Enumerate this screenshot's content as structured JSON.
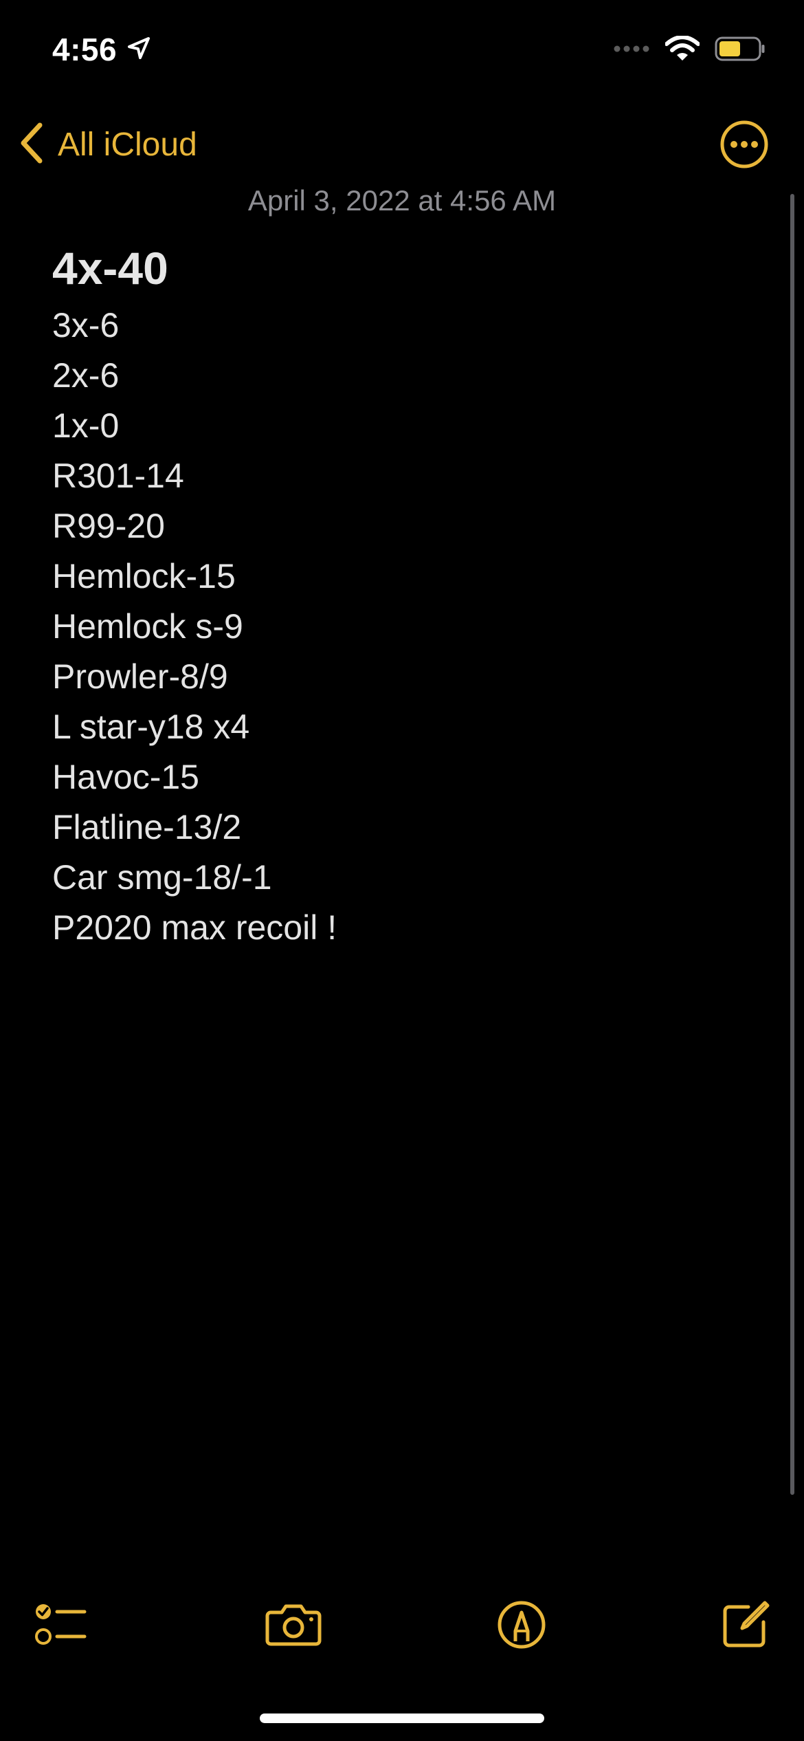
{
  "status_bar": {
    "time": "4:56",
    "icons": [
      "location-arrow-icon",
      "signal-dots-icon",
      "wifi-icon",
      "battery-icon"
    ],
    "battery_color": "#f4d03f"
  },
  "nav": {
    "back_label": "All iCloud",
    "back_icon": "chevron-left-icon",
    "more_icon": "ellipsis-circle-icon",
    "accent_color": "#e8b63a"
  },
  "note": {
    "date": "April 3, 2022 at 4:56 AM",
    "title": "4x-40",
    "lines": [
      "3x-6",
      "2x-6",
      "1x-0",
      "R301-14",
      "R99-20",
      "Hemlock-15",
      "Hemlock s-9",
      "Prowler-8/9",
      "L star-y18 x4",
      "Havoc-15",
      "Flatline-13/2",
      "Car smg-18/-1",
      "P2020 max recoil !"
    ]
  },
  "toolbar": {
    "icons": [
      "checklist-icon",
      "camera-icon",
      "markup-pen-icon",
      "compose-icon"
    ]
  }
}
